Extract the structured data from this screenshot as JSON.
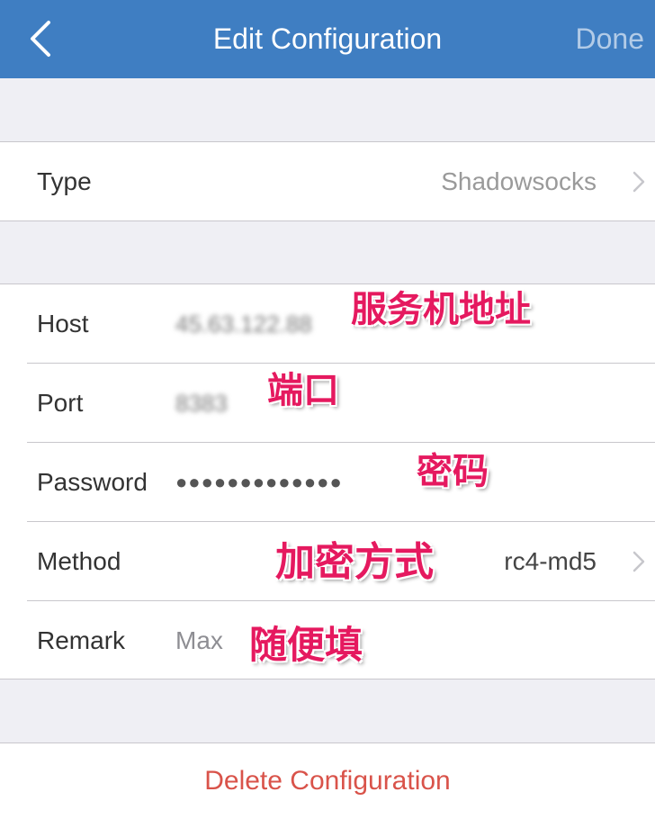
{
  "nav": {
    "title": "Edit Configuration",
    "done_label": "Done",
    "back_icon": "chevron-left-icon",
    "bg_color": "#3f7ec2"
  },
  "type_row": {
    "label": "Type",
    "value": "Shadowsocks",
    "icon": "chevron-right-icon"
  },
  "fields": {
    "host": {
      "label": "Host",
      "value": "45.63.122.88"
    },
    "port": {
      "label": "Port",
      "value": "8383"
    },
    "password": {
      "label": "Password",
      "value": "●●●●●●●●●●●●●"
    },
    "method": {
      "label": "Method",
      "value": "rc4-md5",
      "icon": "chevron-right-icon"
    },
    "remark": {
      "label": "Remark",
      "value": "Max"
    }
  },
  "annotations": {
    "host": "服务机地址",
    "port": "端口",
    "password": "密码",
    "method": "加密方式",
    "remark": "随便填",
    "color": "#e5195f"
  },
  "delete_label": "Delete Configuration",
  "delete_color": "#d9534a"
}
